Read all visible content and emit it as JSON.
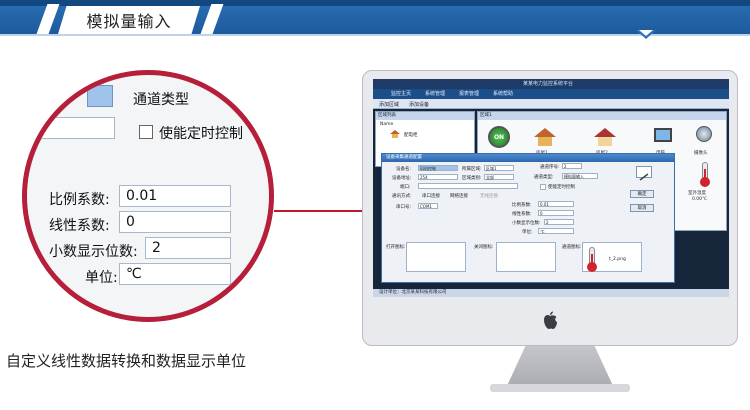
{
  "header": {
    "title": "模拟量输入"
  },
  "zoom": {
    "top_partial_label": "通道类型",
    "checkbox_label": "使能定时控制",
    "fields": [
      {
        "label": "比例系数:",
        "value": "0.01"
      },
      {
        "label": "线性系数:",
        "value": "0"
      },
      {
        "label": "小数显示位数:",
        "value": "2"
      },
      {
        "label": "单位:",
        "value": "℃"
      }
    ]
  },
  "caption": "自定义线性数据转换和数据显示单位",
  "screen": {
    "app_title": "某某电力监控系统平台",
    "menu": [
      "监控主页",
      "系统管理",
      "报表管理",
      "系统帮助"
    ],
    "toolbar": [
      "添加区域",
      "添加设备"
    ],
    "left_panel": {
      "header": "区域列表",
      "items": [
        "Name",
        "配电柜"
      ]
    },
    "main_panel": {
      "header": "区域1",
      "icon_labels": [
        "ON",
        "房屋1",
        "房屋2",
        "电脑",
        "摄像头"
      ],
      "thermo_label": "室外温度",
      "thermo_value": "0.00℃"
    },
    "dialog": {
      "title": "设备采集通道配置",
      "fields": [
        {
          "label": "设备名:",
          "value": "风机控制"
        },
        {
          "label": "设备地址:",
          "value": "254"
        },
        {
          "label": "端口:",
          "value": ""
        },
        {
          "label": "通讯方式:",
          "value": "串口连接"
        },
        {
          "label": "串口号:",
          "value": "COM1"
        }
      ],
      "right_fields": [
        {
          "label": "所属区域:",
          "value": "区域1"
        },
        {
          "label": "区域类别:",
          "value": "全部"
        },
        {
          "label": "通道序号:",
          "value": "2"
        },
        {
          "label": "通道类型:",
          "value": "模拟量输入"
        }
      ],
      "analog": [
        {
          "label": "比例系数:",
          "value": "0.01"
        },
        {
          "label": "线性系数:",
          "value": "0"
        },
        {
          "label": "小数显示位数:",
          "value": "2"
        },
        {
          "label": "单位:",
          "value": "℃"
        }
      ],
      "buttons": [
        "确定",
        "取消"
      ],
      "checkbox_label": "使能定时控制",
      "radio_options": [
        "串口连接",
        "网络连接",
        "无线连接"
      ],
      "box_labels": [
        "打开图标:",
        "关闭图标:",
        "通道图标:"
      ],
      "icon_file": "t_2.png"
    },
    "status_bar": "设计单位：北京某某科技有限公司"
  },
  "colors": {
    "header_blue": "#1c5a9c",
    "zoom_ring": "#b51f3a",
    "connector": "#c0192f"
  }
}
